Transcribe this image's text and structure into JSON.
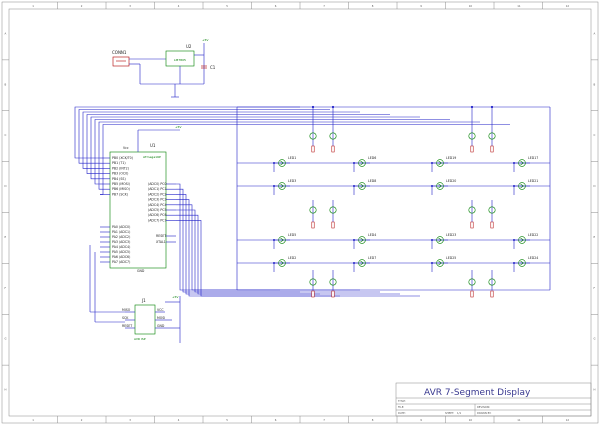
{
  "title_block": {
    "title": "AVR 7-Segment Display",
    "title_label": "TITLE:",
    "file_label": "FILE:",
    "date_label": "DATE:",
    "revision_label": "REVISION:",
    "sheet_label": "SHEET:",
    "drawn_label": "DRAWN BY:",
    "sheet_value": "1/1"
  },
  "components": {
    "connector_ref": "CONN1",
    "regulator_ref": "U2",
    "regulator_part": "LM7805",
    "cap_ref": "C1",
    "supply_label": "+5V",
    "mcu_ref": "U1",
    "mcu_part": "ATmega16P",
    "mcu_vcc": "Vcc",
    "mcu_gnd": "GND",
    "isp_ref": "J1",
    "isp_part": "AVR ISP"
  },
  "mcu_pins_left": [
    "PB0 (XCK/T0)",
    "PB1 (T1)",
    "PB2 (INT2)",
    "PB3 (OC0)",
    "PB4 (SS)",
    "PB5 (MOSI)",
    "PB6 (MISO)",
    "PB7 (SCK)"
  ],
  "mcu_pins_left_lower": [
    "PA0 (ADC0)",
    "PA1 (ADC1)",
    "PA2 (ADC2)",
    "PA3 (ADC3)",
    "PA4 (ADC4)",
    "PA5 (ADC5)",
    "PA6 (ADC6)",
    "PA7 (ADC7)"
  ],
  "mcu_pins_right": [
    "(ADC0) PC0",
    "(ADC1) PC1",
    "(ADC2) PC2",
    "(ADC3) PC3",
    "(ADC4) PC4",
    "(ADC5) PC5",
    "(ADC6) PC6",
    "(ADC7) PC7"
  ],
  "mcu_pins_right_lower": [
    "RESET",
    "XTAL1"
  ],
  "isp_pins": [
    "MISO",
    "SCK",
    "RESET",
    "VCC",
    "MOSI",
    "GND"
  ],
  "leds": {
    "left_group": [
      "LED1",
      "LED2",
      "LED3",
      "LED4",
      "LED5",
      "LED6",
      "LED7",
      "LED8",
      "LED9",
      "LED10",
      "LED11",
      "LED12",
      "LED13",
      "LED14",
      "LED15",
      "LED16"
    ],
    "right_group": [
      "LED17",
      "LED18",
      "LED19",
      "LED20",
      "LED21",
      "LED22",
      "LED23",
      "LED24",
      "LED25",
      "LED26",
      "LED27",
      "LED28",
      "LED29",
      "LED30",
      "LED31",
      "LED32"
    ],
    "labels_shown": [
      "LED1",
      "LED6",
      "LED3",
      "LED8",
      "LED5",
      "LED4",
      "LED2",
      "LED7",
      "LED19",
      "LED17",
      "LED20",
      "LED21",
      "LED23",
      "LED22",
      "LED25",
      "LED24",
      "LED26",
      "LED27"
    ]
  },
  "resistor_ref": "R",
  "border_columns": [
    "1",
    "2",
    "3",
    "4",
    "5",
    "6",
    "7",
    "8",
    "9",
    "10",
    "11",
    "12"
  ],
  "border_rows": [
    "A",
    "B",
    "C",
    "D",
    "E",
    "F",
    "G",
    "H"
  ]
}
